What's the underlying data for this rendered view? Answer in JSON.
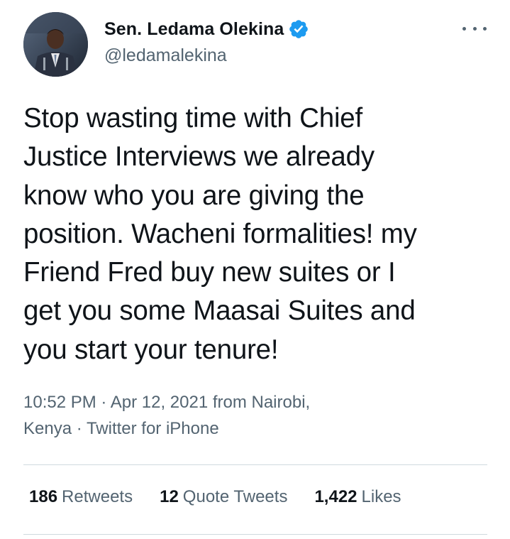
{
  "author": {
    "display_name": "Sen. Ledama Olekina",
    "handle": "@ledamalekina",
    "verified_icon": "verified-badge-icon",
    "avatar": "profile-photo"
  },
  "tweet": {
    "text": "Stop wasting time with Chief\nJustice Interviews we already\nknow who you are giving the\nposition. Wacheni formalities! my\nFriend Fred buy new suites or I\nget you some Maasai Suites and\nyou start your tenure!",
    "meta": "10:52 PM · Apr 12, 2021 from Nairobi,\nKenya · Twitter for iPhone"
  },
  "stats": [
    {
      "count": "186",
      "label": "Retweets"
    },
    {
      "count": "12",
      "label": "Quote Tweets"
    },
    {
      "count": "1,422",
      "label": "Likes"
    }
  ],
  "colors": {
    "verified": "#1d9bf0",
    "secondary_text": "#536471",
    "primary_text": "#0f1419",
    "divider": "#cfd9de"
  }
}
